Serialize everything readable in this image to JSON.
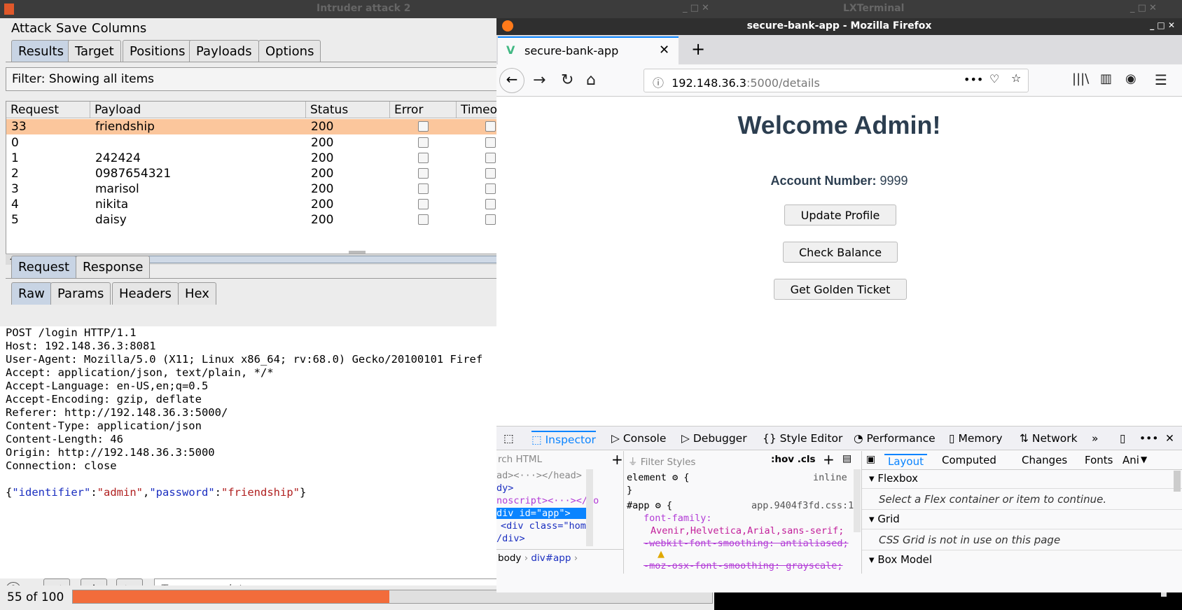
{
  "desktop": {
    "left_window_title": "Intruder attack 2",
    "right_window_title": "LXTerminal",
    "ctrl": "_ □ ✕"
  },
  "burp": {
    "menu": [
      "Attack",
      "Save",
      "Columns"
    ],
    "tabs": [
      "Results",
      "Target",
      "Positions",
      "Payloads",
      "Options"
    ],
    "filter": "Filter: Showing all items",
    "columns": [
      "Request",
      "Payload",
      "Status",
      "Error",
      "Timeou"
    ],
    "rows": [
      {
        "request": "33",
        "payload": "friendship",
        "status": "200"
      },
      {
        "request": "0",
        "payload": "",
        "status": "200"
      },
      {
        "request": "1",
        "payload": "242424",
        "status": "200"
      },
      {
        "request": "2",
        "payload": "0987654321",
        "status": "200"
      },
      {
        "request": "3",
        "payload": "marisol",
        "status": "200"
      },
      {
        "request": "4",
        "payload": "nikita",
        "status": "200"
      },
      {
        "request": "5",
        "payload": "daisy",
        "status": "200"
      }
    ],
    "reqresp_tabs": [
      "Request",
      "Response"
    ],
    "view_tabs": [
      "Raw",
      "Params",
      "Headers",
      "Hex"
    ],
    "raw_lines": [
      "POST /login HTTP/1.1",
      "Host: 192.148.36.3:8081",
      "User-Agent: Mozilla/5.0 (X11; Linux x86_64; rv:68.0) Gecko/20100101 Firef",
      "Accept: application/json, text/plain, */*",
      "Accept-Language: en-US,en;q=0.5",
      "Accept-Encoding: gzip, deflate",
      "Referer: http://192.148.36.3:5000/",
      "Content-Type: application/json",
      "Content-Length: 46",
      "Origin: http://192.148.36.3:5000",
      "Connection: close"
    ],
    "body_json": {
      "k1": "\"identifier\"",
      "v1": "\"admin\"",
      "k2": "\"password\"",
      "v2": "\"friendship\""
    },
    "help": "?",
    "prev": "<",
    "plus": "+",
    "next": ">",
    "search_placeholder": "Type a search term",
    "progress_label": "55 of 100",
    "progress_value": 0.55
  },
  "firefox": {
    "title": "secure-bank-app - Mozilla Firefox",
    "tab_title": "secure-bank-app",
    "url_host": "192.148.36.3",
    "url_rest": ":5000/details",
    "heading": "Welcome Admin!",
    "account_label": "Account Number:",
    "account_value": "9999",
    "buttons": [
      "Update Profile",
      "Check Balance",
      "Get Golden Ticket"
    ],
    "devtools_tabs": [
      "Inspector",
      "Console",
      "Debugger",
      "Style Editor",
      "Performance",
      "Memory",
      "Network"
    ],
    "search_html": "rch HTML",
    "filter_styles": "Filter Styles",
    "hov_cls": ":hov .cls",
    "tree": [
      "ad><···></head>",
      "dy>",
      "noscript><···></no",
      "div id=\"app\">",
      "<div class=\"hom",
      "/div>"
    ],
    "breadcrumb": [
      "body",
      "div#app"
    ],
    "rules": {
      "element": "element",
      "inline": "inline",
      "app_sel": "#app",
      "app_src": "app.9404f3fd.css:1",
      "prop1": "font-family:",
      "val1": "Avenir,Helvetica,Arial,sans-serif;",
      "prop2": "-webkit-font-smoothing: antialiased;",
      "prop3": "-moz-osx-font-smoothing: grayscale;"
    },
    "layout_tabs": [
      "Layout",
      "Computed",
      "Changes",
      "Fonts",
      "Ani"
    ],
    "layout": {
      "flex": "Flexbox",
      "flex_msg": "Select a Flex container or item to continue.",
      "grid": "Grid",
      "grid_msg": "CSS Grid is not in use on this page",
      "box": "Box Model"
    }
  }
}
